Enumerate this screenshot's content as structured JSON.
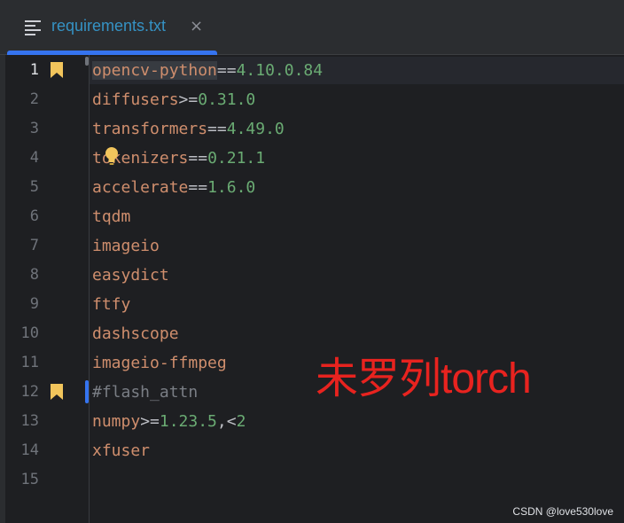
{
  "tab": {
    "title": "requirements.txt",
    "close_glyph": "×",
    "icon": "text-file-icon"
  },
  "editor": {
    "active_line": 1,
    "lines": [
      {
        "num": "1",
        "tokens": [
          {
            "t": "opencv-python",
            "c": "pkg"
          },
          {
            "t": "==",
            "c": "op"
          },
          {
            "t": "4.10.0.84",
            "c": "ver"
          }
        ],
        "bookmark": true
      },
      {
        "num": "2",
        "tokens": [
          {
            "t": "diffusers",
            "c": "pkg"
          },
          {
            "t": ">=",
            "c": "op"
          },
          {
            "t": "0.31.0",
            "c": "ver"
          }
        ],
        "bookmark": false
      },
      {
        "num": "3",
        "tokens": [
          {
            "t": "transformers",
            "c": "pkg"
          },
          {
            "t": "==",
            "c": "op"
          },
          {
            "t": "4.49.0",
            "c": "ver"
          }
        ],
        "bookmark": false
      },
      {
        "num": "4",
        "tokens": [
          {
            "t": "tokenizers",
            "c": "pkg"
          },
          {
            "t": "==",
            "c": "op"
          },
          {
            "t": "0.21.1",
            "c": "ver"
          }
        ],
        "bookmark": false
      },
      {
        "num": "5",
        "tokens": [
          {
            "t": "accelerate",
            "c": "pkg"
          },
          {
            "t": "==",
            "c": "op"
          },
          {
            "t": "1.6.0",
            "c": "ver"
          }
        ],
        "bookmark": false
      },
      {
        "num": "6",
        "tokens": [
          {
            "t": "tqdm",
            "c": "pkg"
          }
        ],
        "bookmark": false
      },
      {
        "num": "7",
        "tokens": [
          {
            "t": "imageio",
            "c": "pkg"
          }
        ],
        "bookmark": false
      },
      {
        "num": "8",
        "tokens": [
          {
            "t": "easydict",
            "c": "pkg"
          }
        ],
        "bookmark": false
      },
      {
        "num": "9",
        "tokens": [
          {
            "t": "ftfy",
            "c": "pkg"
          }
        ],
        "bookmark": false
      },
      {
        "num": "10",
        "tokens": [
          {
            "t": "dashscope",
            "c": "pkg"
          }
        ],
        "bookmark": false
      },
      {
        "num": "11",
        "tokens": [
          {
            "t": "imageio-ffmpeg",
            "c": "pkg"
          }
        ],
        "bookmark": false
      },
      {
        "num": "12",
        "tokens": [
          {
            "t": "#flash_attn",
            "c": "cmt"
          }
        ],
        "bookmark": true
      },
      {
        "num": "13",
        "tokens": [
          {
            "t": "numpy",
            "c": "pkg"
          },
          {
            "t": ">=",
            "c": "op"
          },
          {
            "t": "1.23.5",
            "c": "ver"
          },
          {
            "t": ",<",
            "c": "op"
          },
          {
            "t": "2",
            "c": "ver"
          }
        ],
        "bookmark": false
      },
      {
        "num": "14",
        "tokens": [
          {
            "t": "xfuser",
            "c": "pkg"
          }
        ],
        "bookmark": false
      },
      {
        "num": "15",
        "tokens": [],
        "bookmark": false
      }
    ]
  },
  "annotation": "未罗列torch",
  "watermark": "CSDN @love530love",
  "colors": {
    "background": "#1e1f22",
    "package": "#cf8e6d",
    "version": "#6aab73",
    "operator": "#bcbec4",
    "comment": "#7a7e85",
    "accent": "#3574f0",
    "bookmark": "#f2c55c",
    "annotation": "#e8231f"
  }
}
